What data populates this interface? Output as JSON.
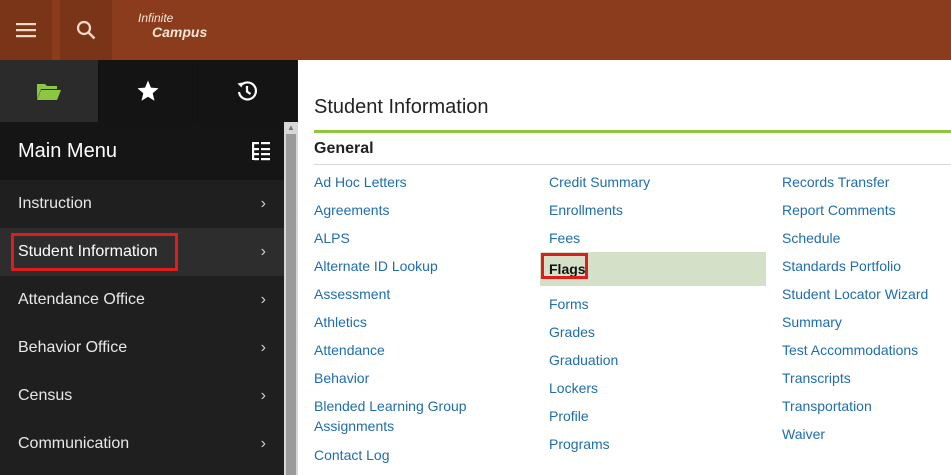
{
  "header": {
    "logo_line1": "Infinite",
    "logo_line2": "Campus",
    "icons": [
      "hamburger-menu-icon",
      "search-icon"
    ]
  },
  "sidebar": {
    "tabs": [
      {
        "icon": "folder-open-icon",
        "active": true
      },
      {
        "icon": "star-icon",
        "active": false
      },
      {
        "icon": "history-icon",
        "active": false
      }
    ],
    "title": "Main Menu",
    "items": [
      {
        "label": "Instruction"
      },
      {
        "label": "Student Information",
        "selected": true
      },
      {
        "label": "Attendance Office"
      },
      {
        "label": "Behavior Office"
      },
      {
        "label": "Census"
      },
      {
        "label": "Communication"
      }
    ]
  },
  "main": {
    "title": "Student Information",
    "section": "General",
    "col1": [
      "Ad Hoc Letters",
      "Agreements",
      "ALPS",
      "Alternate ID Lookup",
      "Assessment",
      "Athletics",
      "Attendance",
      "Behavior",
      "Blended Learning Group",
      "Assignments",
      "Contact Log"
    ],
    "col2": [
      "Credit Summary",
      "Enrollments",
      "Fees",
      "Flags",
      "Forms",
      "Grades",
      "Graduation",
      "Lockers",
      "Profile",
      "Programs"
    ],
    "col3": [
      "Records Transfer",
      "Report Comments",
      "Schedule",
      "Standards Portfolio",
      "Student Locator Wizard",
      "Summary",
      "Test Accommodations",
      "Transcripts",
      "Transportation",
      "Waiver"
    ]
  },
  "colors": {
    "header": "#8b3c1c",
    "sidebar": "#1f1f1f",
    "link": "#1f6dad",
    "accent_rule": "#8dc63f",
    "selected_row": "#d4e0c7",
    "highlight": "#e01d1d"
  }
}
